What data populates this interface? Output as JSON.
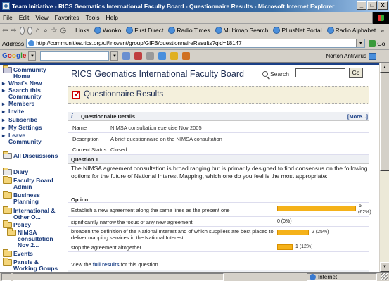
{
  "window": {
    "title": "Team Initiative - RICS Geomatics International Faculty Board - Questionnaire Results - Microsoft Internet Explorer",
    "buttons": [
      "_",
      "□",
      "X"
    ]
  },
  "menu": [
    "File",
    "Edit",
    "View",
    "Favorites",
    "Tools",
    "Help"
  ],
  "toolbar": {
    "links_label": "Links",
    "links": [
      "Wonko",
      "First Direct",
      "Radio Times",
      "Multimap Search",
      "PLusNet Portal",
      "Radio Alphabet"
    ],
    "overflow": "»"
  },
  "address": {
    "label": "Address",
    "url": "http://communities.rics.org/ui/inovent/group/GIFB/questionnaireResults?qid=18147",
    "go": "Go"
  },
  "google": {
    "logo": [
      "G",
      "o",
      "o",
      "g",
      "l",
      "e"
    ],
    "norton": "Norton AntiVirus"
  },
  "sidebar": {
    "community_home": "Community Home",
    "items": [
      "What's New",
      "Search this Community",
      "Members",
      "Invite",
      "Subscribe",
      "My Settings",
      "Leave Community"
    ],
    "all_discussions": "All Discussions",
    "folders": [
      "Diary",
      "Faculty Board Admin",
      "Business Planning",
      "International & Other O...",
      "Policy",
      "NIMSA consultation Nov 2...",
      "Events",
      "Panels & Working Goups"
    ]
  },
  "main": {
    "board_title": "RICS Geomatics International Faculty Board",
    "search_label": "Search",
    "go_label": "Go",
    "section_title": "Questionnaire Results",
    "details": {
      "header": "Questionnaire Details",
      "more": "[More...]",
      "rows": [
        {
          "key": "Name",
          "value": "NIMSA consultation exercise Nov 2005"
        },
        {
          "key": "Description",
          "value": "A brief questionnaire on the NIMSA consultation"
        },
        {
          "key": "Current Status",
          "value": "Closed"
        }
      ]
    },
    "question": {
      "header": "Question 1",
      "text": "The NIMSA agreement consultation is broad ranging but is primarily designed to find consensus on the following options for the future of National Interest Mapping, which one do you feel is the most appropriate:",
      "option_header": "Option",
      "options": [
        {
          "text": "Establish a new agreement along the same lines as the present one",
          "count_label": "5",
          "pct_label": "(62%)",
          "fraction": 0.62
        },
        {
          "text": "significantly narrow the focus of any new agreement",
          "count_label": "0 (0%)",
          "fraction": 0
        },
        {
          "text": "broaden the definition of the National Interest and of which suppliers are best placed to deliver mapping services in the National Interest",
          "count_label": "2 (25%)",
          "fraction": 0.25
        },
        {
          "text": "stop the agreement altogether",
          "count_label": "1 (12%)",
          "fraction": 0.12
        }
      ],
      "full_results_pre": "View the ",
      "full_results_link": "full results",
      "full_results_post": " for this question."
    }
  },
  "status": {
    "zone": "Internet"
  }
}
